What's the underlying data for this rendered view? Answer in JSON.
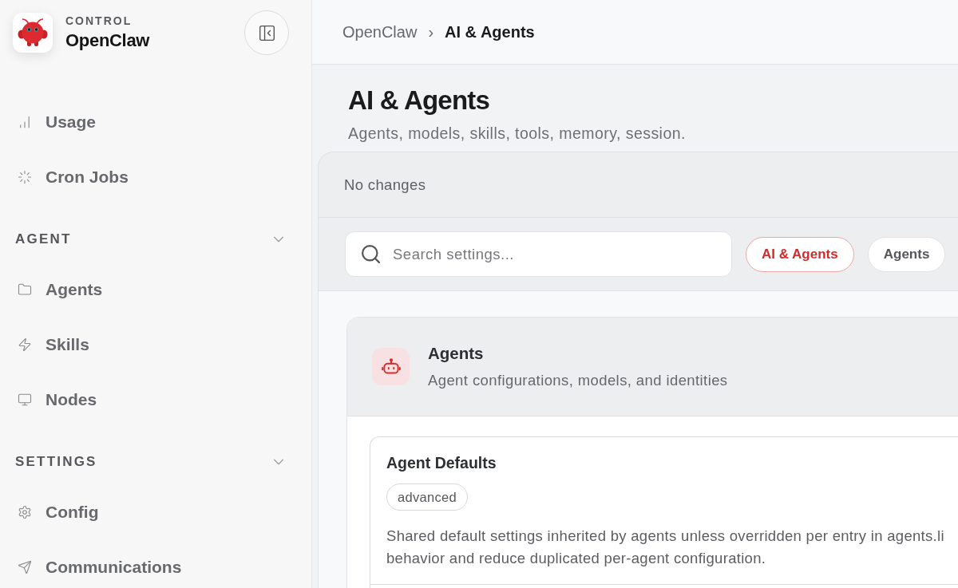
{
  "sidebar": {
    "brand": {
      "kicker": "CONTROL",
      "name": "OpenClaw"
    },
    "top_items": [
      {
        "label": "Usage"
      },
      {
        "label": "Cron Jobs"
      }
    ],
    "sections": [
      {
        "title": "AGENT",
        "expanded": true,
        "items": [
          {
            "label": "Agents"
          },
          {
            "label": "Skills"
          },
          {
            "label": "Nodes"
          }
        ]
      },
      {
        "title": "SETTINGS",
        "expanded": true,
        "items": [
          {
            "label": "Config"
          },
          {
            "label": "Communications"
          }
        ]
      }
    ]
  },
  "breadcrumb": {
    "items": [
      "OpenClaw",
      "AI & Agents"
    ],
    "separator": "›"
  },
  "page": {
    "title": "AI & Agents",
    "subtitle": "Agents, models, skills, tools, memory, session."
  },
  "status_bar": {
    "text": "No changes"
  },
  "search": {
    "placeholder": "Search settings..."
  },
  "filters": [
    {
      "label": "AI & Agents",
      "selected": true
    },
    {
      "label": "Agents",
      "selected": false
    }
  ],
  "section": {
    "title": "Agents",
    "subtitle": "Agent configurations, models, and identities",
    "groups": [
      {
        "title": "Agent Defaults",
        "tag": "advanced",
        "description_lines": [
          "Shared default settings inherited by agents unless overridden per entry in agents.li",
          "behavior and reduce duplicated per-agent configuration."
        ]
      }
    ]
  }
}
